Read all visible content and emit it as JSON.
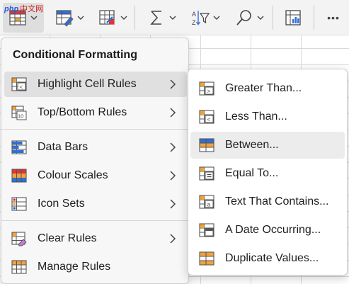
{
  "watermark": {
    "brand": "php",
    "suffix": "中文网"
  },
  "toolbar": {
    "buttons": [
      {
        "name": "conditional-formatting",
        "icon": "conditional-formatting-icon",
        "active": true
      },
      {
        "name": "format-as-table",
        "icon": "format-table-icon",
        "active": false
      },
      {
        "name": "cell-styles",
        "icon": "cell-styles-icon",
        "active": false
      },
      {
        "name": "autosum",
        "icon": "sigma-icon",
        "active": false
      },
      {
        "name": "sort-filter",
        "icon": "sort-filter-icon",
        "active": false
      },
      {
        "name": "find-select",
        "icon": "search-icon",
        "active": false
      },
      {
        "name": "analyze-data",
        "icon": "analyze-data-icon",
        "active": false
      },
      {
        "name": "more",
        "icon": "more-icon",
        "active": false
      }
    ],
    "more_label": "•••"
  },
  "menu": {
    "title": "Conditional Formatting",
    "items": [
      {
        "label": "Highlight Cell Rules",
        "icon": "highlight-cells-icon",
        "has_submenu": true,
        "selected": true
      },
      {
        "label": "Top/Bottom Rules",
        "icon": "top-bottom-icon",
        "has_submenu": true,
        "selected": false
      },
      {
        "label": "Data Bars",
        "icon": "data-bars-icon",
        "has_submenu": true,
        "selected": false
      },
      {
        "label": "Colour Scales",
        "icon": "colour-scales-icon",
        "has_submenu": true,
        "selected": false
      },
      {
        "label": "Icon Sets",
        "icon": "icon-sets-icon",
        "has_submenu": true,
        "selected": false
      },
      {
        "label": "Clear Rules",
        "icon": "clear-rules-icon",
        "has_submenu": true,
        "selected": false
      },
      {
        "label": "Manage Rules",
        "icon": "manage-rules-icon",
        "has_submenu": false,
        "selected": false
      }
    ]
  },
  "submenu": {
    "items": [
      {
        "label": "Greater Than...",
        "icon": "greater-than-icon",
        "hover": false
      },
      {
        "label": "Less Than...",
        "icon": "less-than-icon",
        "hover": false
      },
      {
        "label": "Between...",
        "icon": "between-icon",
        "hover": true
      },
      {
        "label": "Equal To...",
        "icon": "equal-to-icon",
        "hover": false
      },
      {
        "label": "Text That Contains...",
        "icon": "text-contains-icon",
        "hover": false
      },
      {
        "label": "A Date Occurring...",
        "icon": "date-occurring-icon",
        "hover": false
      },
      {
        "label": "Duplicate Values...",
        "icon": "duplicate-values-icon",
        "hover": false
      }
    ]
  },
  "colors": {
    "accent_orange": "#f0a33a",
    "accent_red": "#e0343c",
    "accent_blue": "#2f6fd6",
    "icon_gray": "#555555",
    "selected_bg": "#e0e0e0",
    "hover_bg": "#ececec"
  }
}
